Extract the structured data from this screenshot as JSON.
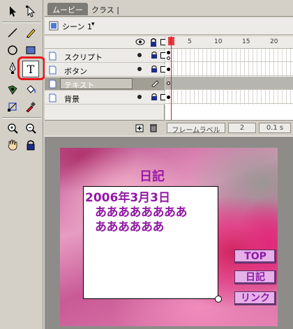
{
  "tabs": {
    "movie": "ムービー",
    "class": "クラス |"
  },
  "scene": {
    "label": "シーン 1",
    "arrow": "▾"
  },
  "layers": [
    {
      "name": "スクリプト",
      "selected": false
    },
    {
      "name": "ボタン",
      "selected": false
    },
    {
      "name": "テキスト",
      "selected": true
    },
    {
      "name": "背景",
      "selected": false
    }
  ],
  "ruler": [
    "1",
    "5",
    "10",
    "15",
    "20"
  ],
  "frame_footer": {
    "frame_label": "フレームラベル",
    "frame_number": "2",
    "time": "0.1 s"
  },
  "tools": [
    "arrow-tool",
    "subselect-tool",
    "line-tool",
    "pencil-tool",
    "oval-tool",
    "rectangle-tool",
    "pen-tool",
    "text-tool",
    "ink-bottle-tool",
    "paint-bucket-tool",
    "transform-tool",
    "eyedropper-tool",
    "zoom-in-tool",
    "zoom-out-tool",
    "hand-tool",
    "lock-tool"
  ],
  "stage": {
    "title": "日記",
    "text_date": "2006年3月3日",
    "text_line1": "ああああああああ",
    "text_line2": "ああああああ",
    "buttons": {
      "top": "TOP",
      "diary": "日記",
      "link": "リンク"
    }
  },
  "colors": {
    "highlight": "#e8141c",
    "text_purple": "#9118a3",
    "button_fill": "#e6b0e8"
  }
}
